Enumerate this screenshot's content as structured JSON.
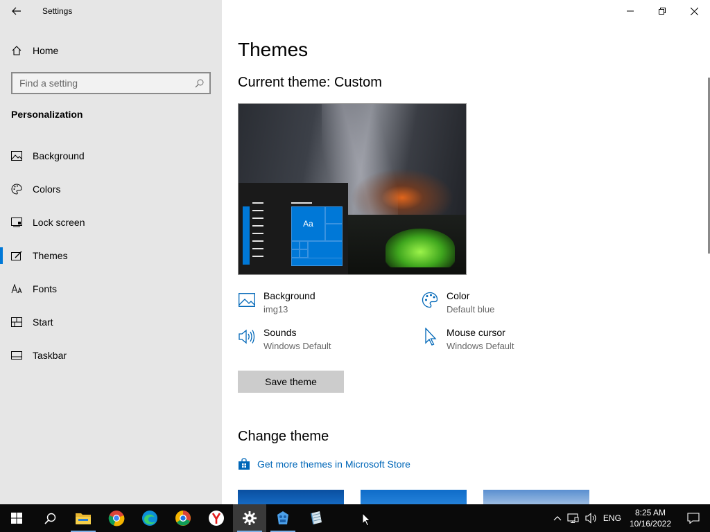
{
  "window": {
    "title": "Settings"
  },
  "sidebar": {
    "home_label": "Home",
    "search_placeholder": "Find a setting",
    "section_title": "Personalization",
    "items": [
      {
        "label": "Background",
        "icon": "picture-icon"
      },
      {
        "label": "Colors",
        "icon": "palette-icon"
      },
      {
        "label": "Lock screen",
        "icon": "lock-screen-icon"
      },
      {
        "label": "Themes",
        "icon": "themes-icon",
        "active": true
      },
      {
        "label": "Fonts",
        "icon": "fonts-icon"
      },
      {
        "label": "Start",
        "icon": "start-icon"
      },
      {
        "label": "Taskbar",
        "icon": "taskbar-icon"
      }
    ]
  },
  "main": {
    "title": "Themes",
    "current_theme": "Current theme: Custom",
    "preview_tile_text": "Aa",
    "properties": [
      {
        "name": "Background",
        "value": "img13",
        "icon": "picture-icon"
      },
      {
        "name": "Color",
        "value": "Default blue",
        "icon": "palette-icon"
      },
      {
        "name": "Sounds",
        "value": "Windows Default",
        "icon": "speaker-icon"
      },
      {
        "name": "Mouse cursor",
        "value": "Windows Default",
        "icon": "cursor-icon"
      }
    ],
    "save_button": "Save theme",
    "change_theme_title": "Change theme",
    "store_link": "Get more themes in Microsoft Store"
  },
  "taskbar": {
    "apps": [
      "start-icon",
      "search-icon",
      "file-explorer-icon",
      "chrome-icon",
      "edge-icon",
      "browser-icon",
      "yandex-icon",
      "settings-icon",
      "app-icon",
      "notepad-icon"
    ],
    "language": "ENG",
    "time": "8:25 AM",
    "date": "10/16/2022"
  },
  "colors": {
    "accent": "#0078d7",
    "sidebar_bg": "#e6e6e6",
    "link": "#0067b8",
    "taskbar": "#0a0a0a"
  }
}
